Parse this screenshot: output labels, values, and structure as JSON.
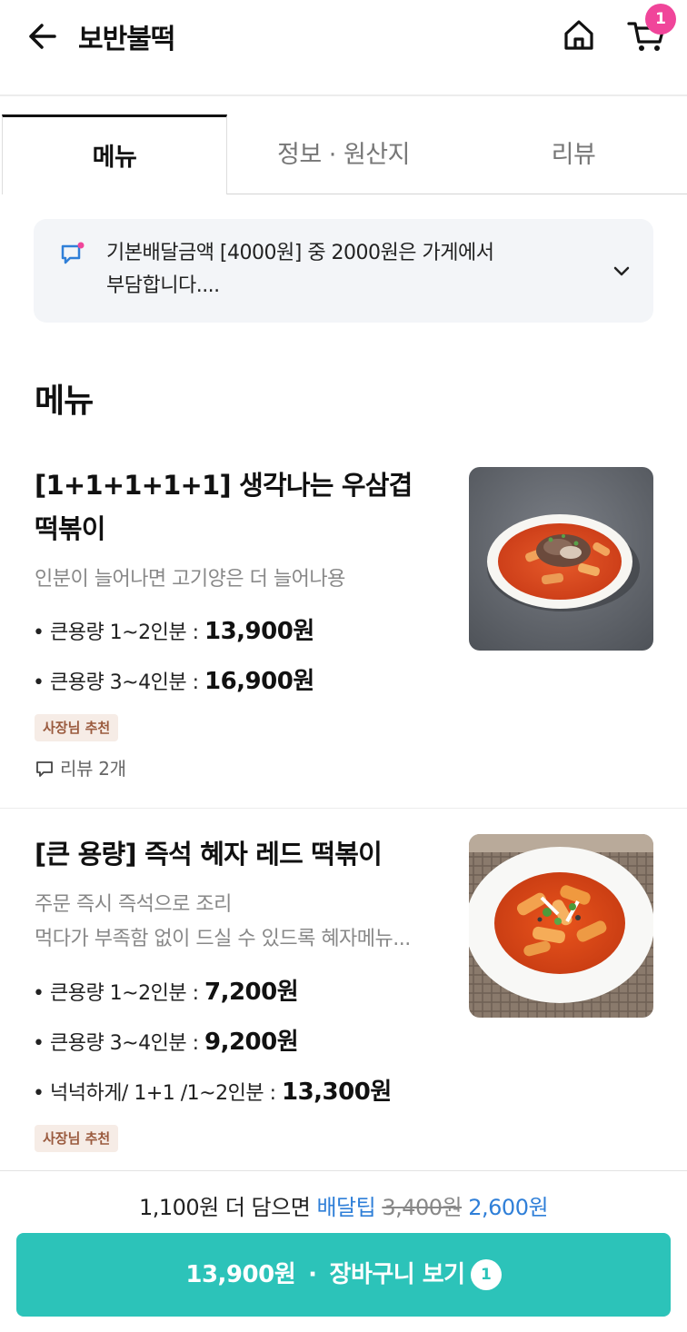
{
  "header": {
    "title": "보반불떡",
    "cart_count": "1"
  },
  "tabs": [
    {
      "label": "메뉴",
      "active": true
    },
    {
      "label": "정보 · 원산지",
      "active": false
    },
    {
      "label": "리뷰",
      "active": false
    }
  ],
  "notice": {
    "line1": "기본배달금액 [4000원] 중 2000원은 가게에서",
    "line2": "부담합니다...."
  },
  "section_title": "메뉴",
  "items": [
    {
      "name_line1": "[1+1+1+1+1] 생각나는 우삼겹",
      "name_line2": "떡볶이",
      "desc1": "인분이 늘어나면 고기양은 더 늘어나용",
      "prices": [
        {
          "label": "• 큰용량 1~2인분 : ",
          "price": "13,900원"
        },
        {
          "label": "• 큰용량 3~4인분 : ",
          "price": "16,900원"
        }
      ],
      "badge": "사장님 추천",
      "review": "리뷰 2개"
    },
    {
      "name_line1": "[큰 용량] 즉석 혜자 레드 떡볶이",
      "desc1": "주문 즉시 즉석으로 조리",
      "desc2": "먹다가 부족함 없이 드실 수 있드록 혜자메뉴...",
      "prices": [
        {
          "label": "• 큰용량 1~2인분 : ",
          "price": "7,200원"
        },
        {
          "label": "• 큰용량 3~4인분 : ",
          "price": "9,200원"
        },
        {
          "label": "• 넉넉하게/ 1+1 /1~2인분 : ",
          "price": "13,300원"
        }
      ],
      "badge": "사장님 추천"
    }
  ],
  "bottom": {
    "tip_prefix": "1,100원 더 담으면 ",
    "tip_label": "배달팁",
    "tip_old": "3,400원",
    "tip_new": "2,600원",
    "cart_price": "13,900원",
    "cart_separator": "·",
    "cart_label": "장바구니 보기",
    "cart_count": "1"
  },
  "colors": {
    "accent": "#2cc3b9",
    "badge_pink": "#f0459a",
    "link_blue": "#2f7fd8"
  }
}
